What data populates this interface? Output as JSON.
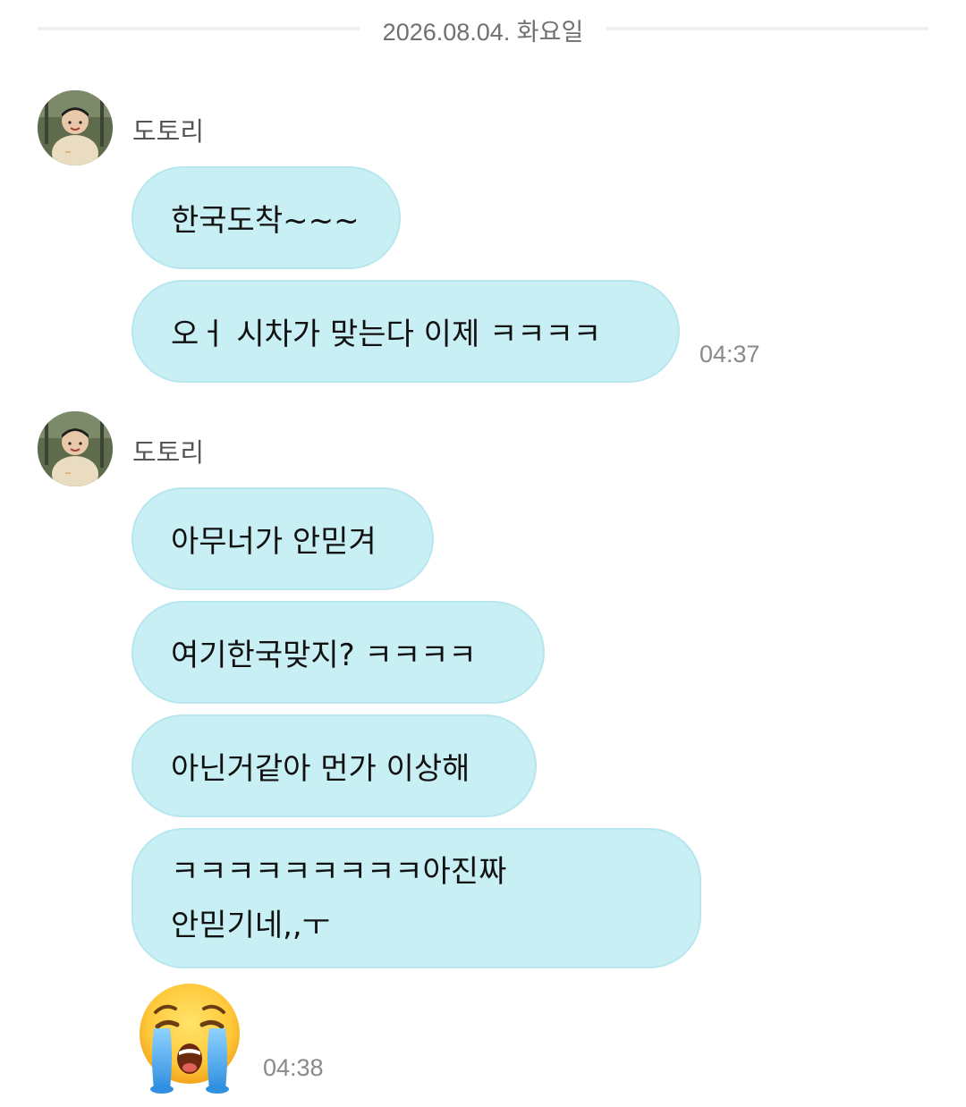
{
  "date_divider": "2026.08.04. 화요일",
  "messages": [
    {
      "sender": "도토리",
      "bubbles": [
        "한국도착~~~",
        "오ㅓ 시차가 맞는다 이제 ㅋㅋㅋㅋ"
      ],
      "time": "04:37"
    },
    {
      "sender": "도토리",
      "bubbles": [
        "아무너가 안믿겨",
        "여기한국맞지? ㅋㅋㅋㅋ",
        "아닌거같아 먼가 이상해",
        "ㅋㅋㅋㅋㅋㅋㅋㅋㅋ아진짜\n안믿기네,,ㅜ"
      ],
      "sticker": "loudly-crying-face-emoji",
      "time": "04:38"
    }
  ],
  "colors": {
    "bubble": "#c8f0f4",
    "bubble_border": "#b7e6ee",
    "time": "#8a8a8a",
    "divider_line": "#f0f0f0"
  }
}
